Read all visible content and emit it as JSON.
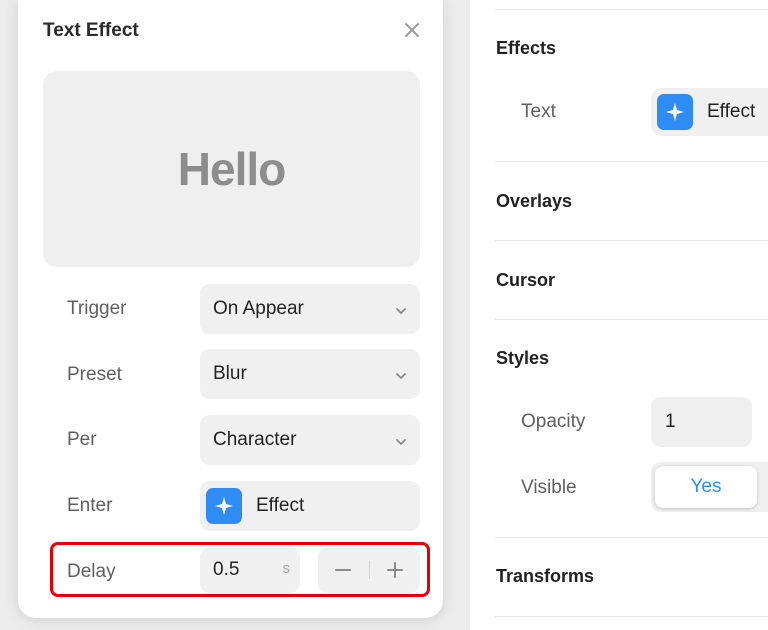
{
  "modal": {
    "title": "Text Effect",
    "preview_text": "Hello",
    "rows": {
      "trigger": {
        "label": "Trigger",
        "value": "On Appear"
      },
      "preset": {
        "label": "Preset",
        "value": "Blur"
      },
      "per": {
        "label": "Per",
        "value": "Character"
      },
      "enter": {
        "label": "Enter",
        "value": "Effect"
      },
      "delay": {
        "label": "Delay",
        "value": "0.5",
        "unit": "s"
      }
    }
  },
  "properties": {
    "effects": {
      "heading": "Effects",
      "text_label": "Text",
      "text_value": "Effect"
    },
    "overlays": {
      "heading": "Overlays"
    },
    "cursor": {
      "heading": "Cursor"
    },
    "styles": {
      "heading": "Styles",
      "opacity_label": "Opacity",
      "opacity_value": "1",
      "visible_label": "Visible",
      "visible_value": "Yes"
    },
    "transforms": {
      "heading": "Transforms"
    }
  },
  "colors": {
    "accent": "#2f8cf5",
    "highlight": "#e00000"
  }
}
